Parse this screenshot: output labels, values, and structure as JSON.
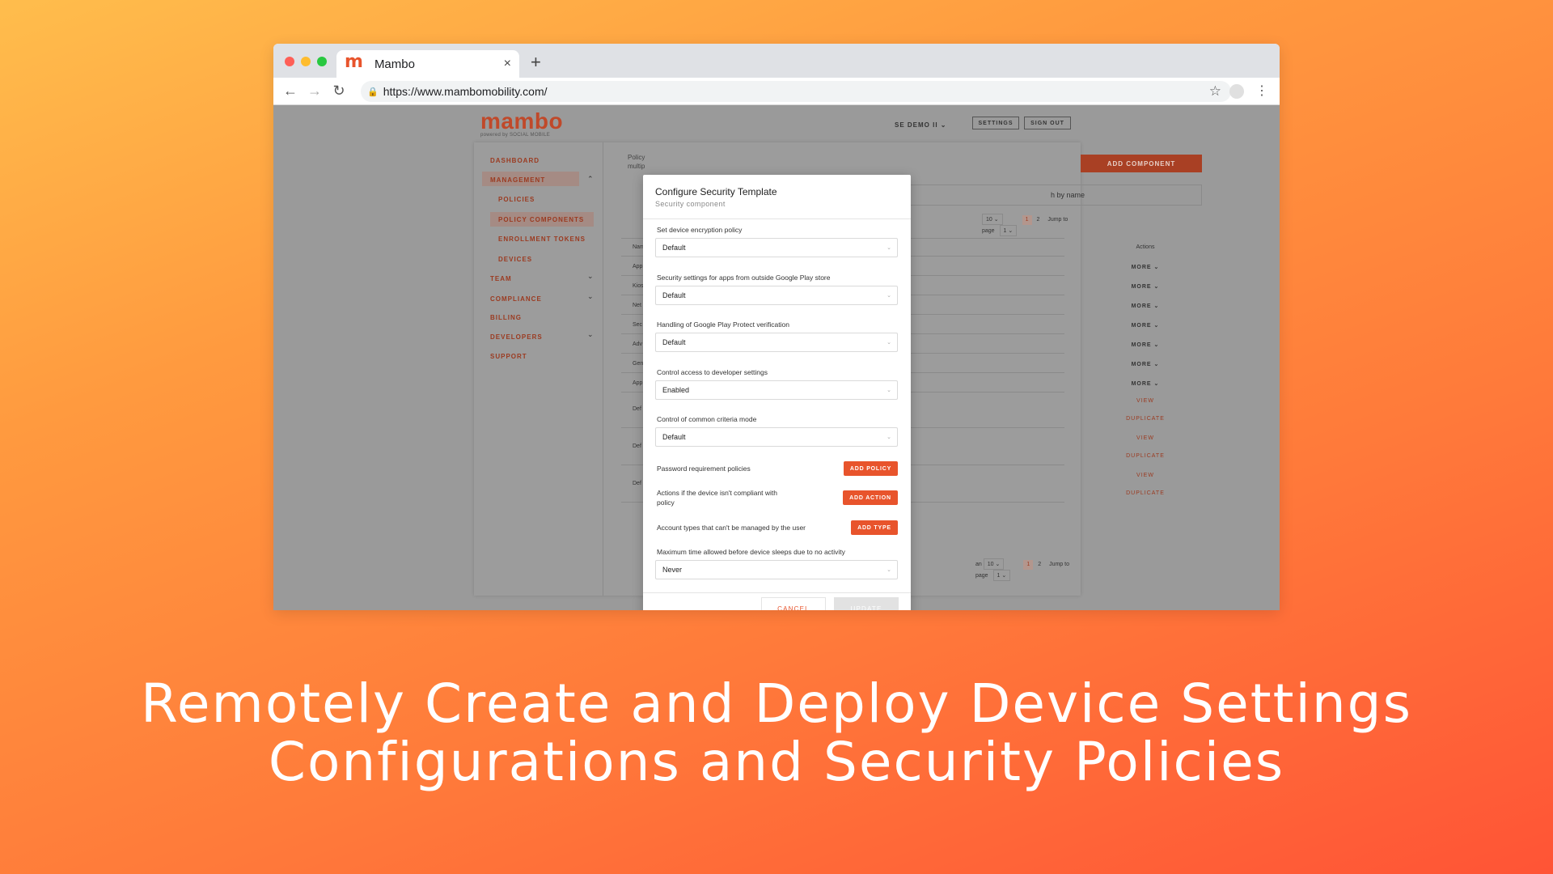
{
  "browser": {
    "tab_title": "Mambo",
    "tab_favicon": "m",
    "tab_close": "×",
    "new_tab": "+",
    "url": "https://www.mambomobility.com/",
    "icons": [
      "back-arrow-icon",
      "forward-arrow-icon",
      "reload-icon",
      "lock-icon",
      "star-icon",
      "profile-icon",
      "kebab-menu-icon"
    ]
  },
  "app": {
    "logo_text": "mambo",
    "logo_sub": "powered by SOCIAL MOBILE",
    "account_label": "SE DEMO II",
    "settings_label": "SETTINGS",
    "signout_label": "SIGN OUT",
    "sidebar": {
      "dashboard": "DASHBOARD",
      "management": "MANAGEMENT",
      "policies": "POLICIES",
      "policy_components": "POLICY COMPONENTS",
      "enrollment_tokens": "ENROLLMENT TOKENS",
      "devices": "DEVICES",
      "team": "TEAM",
      "compliance": "COMPLIANCE",
      "billing": "BILLING",
      "developers": "DEVELOPERS",
      "support": "SUPPORT"
    },
    "content": {
      "intro_line1": "Policy",
      "intro_line2": "multip",
      "add_component": "ADD COMPONENT",
      "search_placeholder": "h by name",
      "page_size": "10",
      "pager_one": "1",
      "pager_two": "2",
      "jump_label": "Jump to page",
      "jump_value": "1",
      "col_name": "Nam",
      "col_actions": "Actions",
      "rows": [
        {
          "name": "App",
          "action": "MORE"
        },
        {
          "name": "Kios",
          "action": "MORE"
        },
        {
          "name": "Net",
          "action": "MORE"
        },
        {
          "name": "Sec",
          "action": "MORE"
        },
        {
          "name": "Adv",
          "action": "MORE"
        },
        {
          "name": "Gen",
          "action": "MORE"
        },
        {
          "name": "App",
          "action": "MORE"
        },
        {
          "name": "Def",
          "view": "VIEW",
          "duplicate": "DUPLICATE"
        },
        {
          "name": "Def",
          "view": "VIEW",
          "duplicate": "DUPLICATE"
        },
        {
          "name": "Def",
          "view": "VIEW",
          "duplicate": "DUPLICATE"
        }
      ],
      "bottom_an": "an"
    }
  },
  "modal": {
    "title": "Configure Security Template",
    "subtitle": "Security component",
    "fields": [
      {
        "label": "Set device encryption policy",
        "value": "Default"
      },
      {
        "label": "Security settings for apps from outside Google Play store",
        "value": "Default"
      },
      {
        "label": "Handling of Google Play Protect verification",
        "value": "Default"
      },
      {
        "label": "Control access to developer settings",
        "value": "Enabled"
      },
      {
        "label": "Control of common criteria mode",
        "value": "Default"
      }
    ],
    "password_label": "Password requirement policies",
    "add_policy": "ADD POLICY",
    "noncompliant_label_1": "Actions if the device isn't compliant with",
    "noncompliant_label_2": "policy",
    "add_action": "ADD ACTION",
    "account_types_label": "Account types that can't be managed by the user",
    "add_type": "ADD TYPE",
    "sleep_label": "Maximum time allowed before device sleeps due to no activity",
    "sleep_value": "Never",
    "cancel": "CANCEL",
    "update": "UPDATE"
  },
  "caption": {
    "line1": "Remotely Create and Deploy Device Settings",
    "line2": "Configurations and Security Policies"
  }
}
